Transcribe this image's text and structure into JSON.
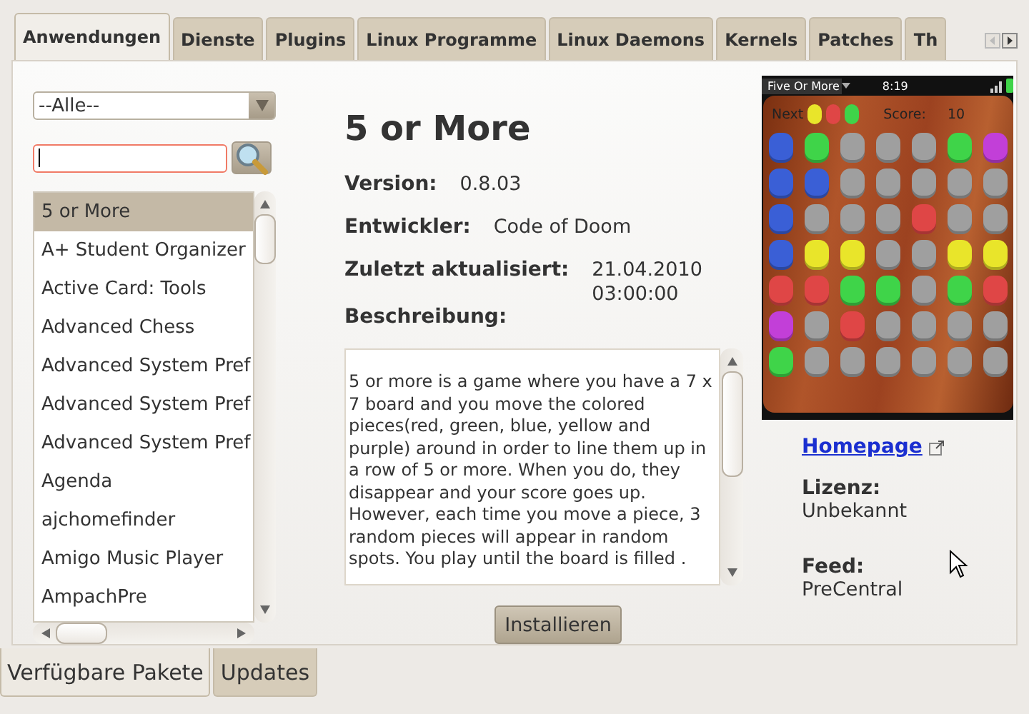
{
  "tabs": [
    {
      "label": "Anwendungen",
      "selected": true
    },
    {
      "label": "Dienste",
      "selected": false
    },
    {
      "label": "Plugins",
      "selected": false
    },
    {
      "label": "Linux Programme",
      "selected": false
    },
    {
      "label": "Linux Daemons",
      "selected": false
    },
    {
      "label": "Kernels",
      "selected": false
    },
    {
      "label": "Patches",
      "selected": false
    },
    {
      "label": "Th",
      "selected": false
    }
  ],
  "filter": {
    "value": "--Alle--"
  },
  "search": {
    "focused": true
  },
  "apps": [
    {
      "name": "5 or More",
      "selected": true
    },
    {
      "name": "A+ Student Organizer",
      "selected": false
    },
    {
      "name": "Active Card: Tools",
      "selected": false
    },
    {
      "name": "Advanced Chess",
      "selected": false
    },
    {
      "name": "Advanced System Pref",
      "selected": false
    },
    {
      "name": "Advanced System Pref",
      "selected": false
    },
    {
      "name": "Advanced System Pref",
      "selected": false
    },
    {
      "name": "Agenda",
      "selected": false
    },
    {
      "name": "ajchomefinder",
      "selected": false
    },
    {
      "name": "Amigo Music Player",
      "selected": false
    },
    {
      "name": "AmpachPre",
      "selected": false
    }
  ],
  "detail": {
    "title": "5 or More",
    "fields": [
      {
        "label": "Version:",
        "value": "0.8.03"
      },
      {
        "label": "Entwickler:",
        "value": "Code of Doom"
      },
      {
        "label": "Zuletzt aktualisiert:",
        "value": "21.04.2010 03:00:00"
      }
    ],
    "description_label": "Beschreibung:",
    "description": "5 or more is a game where you have a 7 x 7 board and you move the colored pieces(red, green, blue, yellow and purple) around in order to line them up in a row of 5 or more. When you do, they disappear and your score goes up. However, each time you move a piece, 3 random pieces will appear in random spots. You play until the board is filled .",
    "install_button": "Installieren"
  },
  "screenshot": {
    "app_title": "Five Or More",
    "time": "8:19",
    "next_label": "Next",
    "score_label": "Score:",
    "score": "10",
    "next": [
      {
        "color": "#e9e52a"
      },
      {
        "color": "#df4646"
      },
      {
        "color": "#3fd449"
      }
    ],
    "board": [
      {
        "pieces": [
          {
            "color": "#3a5fd6"
          },
          {
            "color": "#3fd449"
          },
          {
            "color": "#9f9f9f"
          },
          {
            "color": "#9f9f9f"
          },
          {
            "color": "#9f9f9f"
          },
          {
            "color": "#3fd449"
          },
          {
            "color": "#c23fd8"
          }
        ]
      },
      {
        "pieces": [
          {
            "color": "#3a5fd6"
          },
          {
            "color": "#3a5fd6"
          },
          {
            "color": "#9f9f9f"
          },
          {
            "color": "#9f9f9f"
          },
          {
            "color": "#9f9f9f"
          },
          {
            "color": "#9f9f9f"
          },
          {
            "color": "#9f9f9f"
          }
        ]
      },
      {
        "pieces": [
          {
            "color": "#3a5fd6"
          },
          {
            "color": "#9f9f9f"
          },
          {
            "color": "#9f9f9f"
          },
          {
            "color": "#9f9f9f"
          },
          {
            "color": "#df4646"
          },
          {
            "color": "#9f9f9f"
          },
          {
            "color": "#9f9f9f"
          }
        ]
      },
      {
        "pieces": [
          {
            "color": "#3a5fd6"
          },
          {
            "color": "#e9e52a"
          },
          {
            "color": "#e9e52a"
          },
          {
            "color": "#9f9f9f"
          },
          {
            "color": "#9f9f9f"
          },
          {
            "color": "#e9e52a"
          },
          {
            "color": "#e9e52a"
          }
        ]
      },
      {
        "pieces": [
          {
            "color": "#df4646"
          },
          {
            "color": "#df4646"
          },
          {
            "color": "#3fd449"
          },
          {
            "color": "#3fd449"
          },
          {
            "color": "#9f9f9f"
          },
          {
            "color": "#3fd449"
          },
          {
            "color": "#df4646"
          }
        ]
      },
      {
        "pieces": [
          {
            "color": "#c23fd8"
          },
          {
            "color": "#9f9f9f"
          },
          {
            "color": "#df4646"
          },
          {
            "color": "#9f9f9f"
          },
          {
            "color": "#9f9f9f"
          },
          {
            "color": "#9f9f9f"
          },
          {
            "color": "#9f9f9f"
          }
        ]
      },
      {
        "pieces": [
          {
            "color": "#3fd449"
          },
          {
            "color": "#9f9f9f"
          },
          {
            "color": "#9f9f9f"
          },
          {
            "color": "#9f9f9f"
          },
          {
            "color": "#9f9f9f"
          },
          {
            "color": "#9f9f9f"
          },
          {
            "color": "#9f9f9f"
          }
        ]
      }
    ]
  },
  "homepage": "Homepage",
  "license": {
    "label": "Lizenz:",
    "value": "Unbekannt"
  },
  "feed": {
    "label": "Feed:",
    "value": "PreCentral"
  },
  "bottom_tabs": [
    {
      "label": "Verfügbare Pakete",
      "selected": true
    },
    {
      "label": "Updates",
      "selected": false
    }
  ]
}
